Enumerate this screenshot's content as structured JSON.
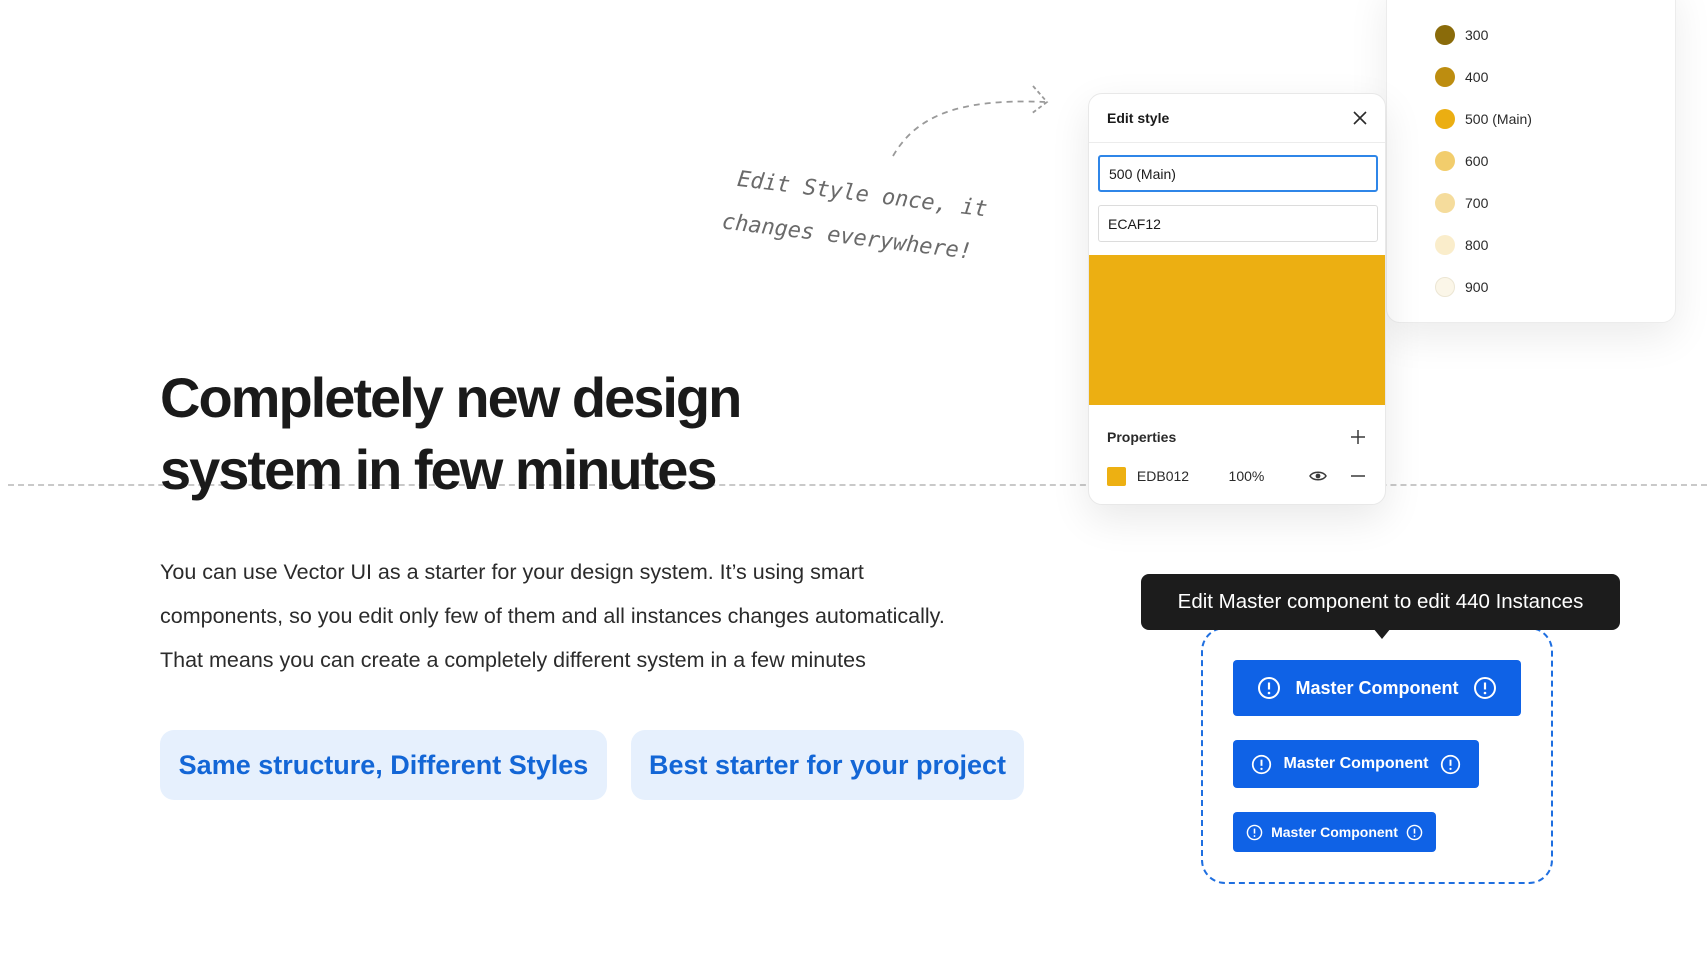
{
  "hero": {
    "headline_line1": "Completely new design",
    "headline_line2": "system in few minutes",
    "body_line1": "You can use Vector UI as a starter for your design system. It’s using smart",
    "body_line2": "components, so you edit only few of them and all instances changes automatically.",
    "body_line3": "That means you can create a completely different system in a few minutes",
    "pill_1": "Same structure, Different Styles",
    "pill_2": "Best starter for your project"
  },
  "annotation": {
    "line1": "Edit Style once, it",
    "line2": "changes everywhere!"
  },
  "edit_style": {
    "title": "Edit style",
    "name_value": "500 (Main)",
    "hex_value": "ECAF12",
    "swatch_color": "#ECAF12",
    "properties_title": "Properties",
    "property": {
      "hex": "EDB012",
      "opacity": "100%",
      "color": "#EDB012"
    },
    "icons": [
      "close-icon",
      "plus-icon",
      "eye-icon",
      "minus-icon"
    ]
  },
  "palette": {
    "items": [
      {
        "label": "300",
        "color": "#8a6b0a"
      },
      {
        "label": "400",
        "color": "#bd8d10"
      },
      {
        "label": "500 (Main)",
        "color": "#ebae12"
      },
      {
        "label": "600",
        "color": "#f2cd6c"
      },
      {
        "label": "700",
        "color": "#f5dc9c"
      },
      {
        "label": "800",
        "color": "#faedcb"
      },
      {
        "label": "900",
        "color": "#fbf6e8"
      }
    ]
  },
  "master": {
    "tooltip": "Edit Master component to edit 440 Instances",
    "button_label": "Master Component",
    "accent": "#0f62e6",
    "icon": "info-circle-icon"
  }
}
